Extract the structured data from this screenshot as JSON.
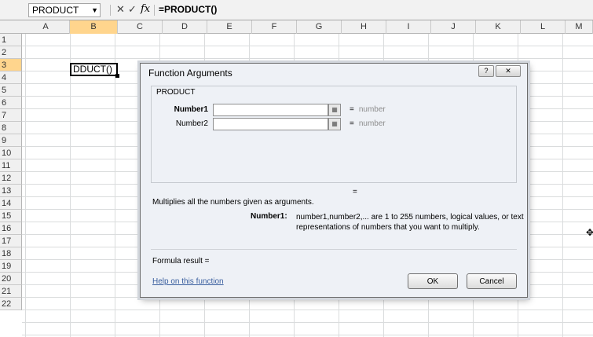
{
  "formula_bar": {
    "name_box": "PRODUCT",
    "dropdown_icon": "▼",
    "cancel_icon": "✕",
    "enter_icon": "✓",
    "fx_icon": "fx",
    "formula": "=PRODUCT()"
  },
  "columns": [
    "A",
    "B",
    "C",
    "D",
    "E",
    "F",
    "G",
    "H",
    "I",
    "J",
    "K",
    "L",
    "M"
  ],
  "rows": [
    "1",
    "2",
    "3",
    "4",
    "5",
    "6",
    "7",
    "8",
    "9",
    "10",
    "11",
    "12",
    "13",
    "14",
    "15",
    "16",
    "17",
    "18",
    "19",
    "20",
    "21",
    "22"
  ],
  "active_cell": {
    "value": "DDUCT()"
  },
  "dialog": {
    "title": "Function Arguments",
    "help_icon": "?",
    "close_icon": "✕",
    "function_name": "PRODUCT",
    "args": [
      {
        "label": "Number1",
        "value": "",
        "result": "number"
      },
      {
        "label": "Number2",
        "value": "",
        "result": "number"
      }
    ],
    "eq_sign": "=",
    "result_eq": "=",
    "description": "Multiplies all the numbers given as arguments.",
    "arg_help_label": "Number1:",
    "arg_help_text": "number1,number2,... are 1 to 255 numbers, logical values, or text representations of numbers that you want to multiply.",
    "formula_result": "Formula result =",
    "help_link": "Help on this function",
    "ok": "OK",
    "cancel": "Cancel"
  }
}
